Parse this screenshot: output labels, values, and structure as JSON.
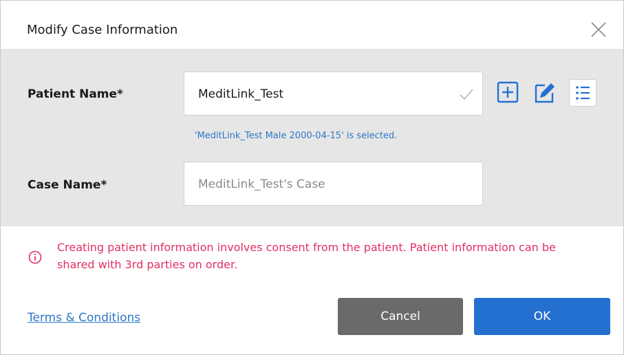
{
  "dialog": {
    "title": "Modify Case Information"
  },
  "form": {
    "patient_name_label": "Patient Name*",
    "patient_name_value": "MeditLink_Test",
    "selected_message": "'MeditLink_Test Male 2000-04-15' is selected.",
    "case_name_label": "Case Name*",
    "case_name_placeholder": "MeditLink_Test's Case"
  },
  "icons": {
    "close": "close-icon",
    "check": "check-icon",
    "add": "add-patient-icon",
    "edit": "edit-patient-icon",
    "list": "patient-list-icon",
    "warning": "info-warning-icon"
  },
  "notice": {
    "text": "Creating patient information involves consent from the patient. Patient information can be shared with 3rd parties on order."
  },
  "footer": {
    "terms_link": "Terms & Conditions",
    "cancel_label": "Cancel",
    "ok_label": "OK"
  },
  "colors": {
    "accent": "#2470d1",
    "warning": "#e0305f",
    "cancel": "#6a6a6a",
    "form_bg": "#e6e6e6"
  }
}
